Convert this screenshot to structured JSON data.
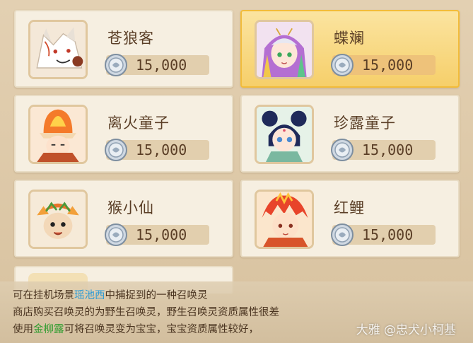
{
  "cards": [
    {
      "name": "苍狼客",
      "price": "15,000",
      "selected": false,
      "avatar": "white-wolf-portrait"
    },
    {
      "name": "蝶斓",
      "price": "15,000",
      "selected": true,
      "avatar": "butterfly-girl-portrait"
    },
    {
      "name": "离火童子",
      "price": "15,000",
      "selected": false,
      "avatar": "fire-child-portrait"
    },
    {
      "name": "珍露童子",
      "price": "15,000",
      "selected": false,
      "avatar": "dew-child-portrait"
    },
    {
      "name": "猴小仙",
      "price": "15,000",
      "selected": false,
      "avatar": "monkey-immortal-portrait"
    },
    {
      "name": "红鲤",
      "price": "15,000",
      "selected": false,
      "avatar": "red-carp-portrait"
    }
  ],
  "description": {
    "line1_pre": "可在挂机场景",
    "line1_place": "瑶池西",
    "line1_post": "中捕捉到的一种召唤灵",
    "line2": "商店购买召唤灵的为野生召唤灵，野生召唤灵资质属性很差",
    "line3_pre": "使用",
    "line3_item": "金柳露",
    "line3_post": "可将召唤灵变为宝宝，宝宝资质属性较好，"
  },
  "watermark": "大雅 @忠犬小柯基",
  "colors": {
    "selected_bg": "#f6cf6a",
    "card_bg": "#f6efe1",
    "place_color": "#2a9ad6",
    "item_color": "#2f9c2f"
  }
}
